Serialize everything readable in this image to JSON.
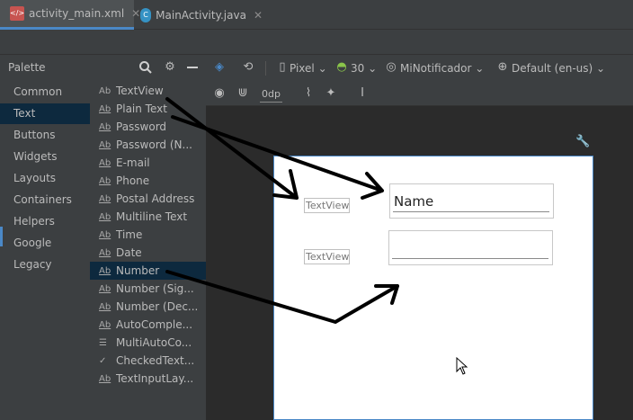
{
  "tabs": [
    {
      "label": "activity_main.xml",
      "active": true,
      "icon": "xml-file-icon"
    },
    {
      "label": "MainActivity.java",
      "active": false,
      "icon": "java-class-icon"
    }
  ],
  "palette": {
    "title": "Palette",
    "categories": [
      "Common",
      "Text",
      "Buttons",
      "Widgets",
      "Layouts",
      "Containers",
      "Helpers",
      "Google",
      "Legacy"
    ],
    "selected_category": "Text",
    "items": [
      {
        "label": "TextView",
        "icon": "Ab"
      },
      {
        "label": "Plain Text",
        "icon": "Ab"
      },
      {
        "label": "Password",
        "icon": "Ab"
      },
      {
        "label": "Password (N...",
        "icon": "Ab"
      },
      {
        "label": "E-mail",
        "icon": "Ab"
      },
      {
        "label": "Phone",
        "icon": "Ab"
      },
      {
        "label": "Postal Address",
        "icon": "Ab"
      },
      {
        "label": "Multiline Text",
        "icon": "Ab"
      },
      {
        "label": "Time",
        "icon": "Ab"
      },
      {
        "label": "Date",
        "icon": "Ab"
      },
      {
        "label": "Number",
        "icon": "Ab"
      },
      {
        "label": "Number (Sig...",
        "icon": "Ab"
      },
      {
        "label": "Number (Dec...",
        "icon": "Ab"
      },
      {
        "label": "AutoComple...",
        "icon": "Ab"
      },
      {
        "label": "MultiAutoCo...",
        "icon": "multi-list-icon"
      },
      {
        "label": "CheckedText...",
        "icon": "check-text-icon"
      },
      {
        "label": "TextInputLay...",
        "icon": "Ab"
      }
    ],
    "selected_item": "Number"
  },
  "toolbar": {
    "device": "Pixel",
    "api": "30",
    "theme": "MiNotificador",
    "locale": "Default (en-us)",
    "margin": "0dp"
  },
  "layout": {
    "textview1": "TextView",
    "textview2": "TextView",
    "edittext1": "Name",
    "edittext2": ""
  },
  "colors": {
    "accent": "#4a88c7",
    "selection": "#0d293e",
    "panel": "#3c3f41",
    "editor_bg": "#2b2b2b"
  }
}
